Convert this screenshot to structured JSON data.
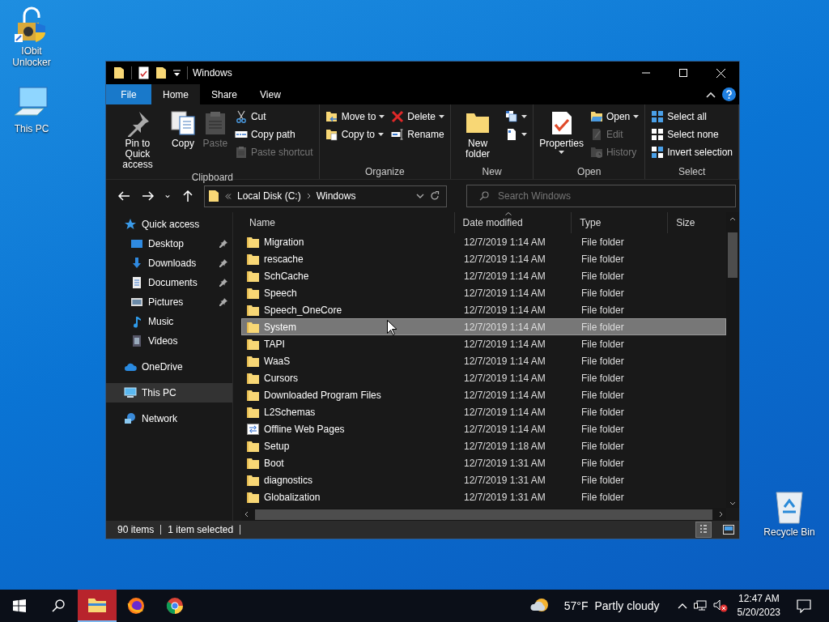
{
  "desktop_icons": [
    {
      "label": "IObit Unlocker",
      "kind": "unlocker"
    },
    {
      "label": "This PC",
      "kind": "pc"
    },
    {
      "label": "Recycle Bin",
      "kind": "bin"
    }
  ],
  "window": {
    "title": "Windows",
    "ribbon_tabs": [
      {
        "label": "File",
        "kind": "file",
        "selected": false
      },
      {
        "label": "Home",
        "kind": "tab",
        "selected": true
      },
      {
        "label": "Share",
        "kind": "tab",
        "selected": false
      },
      {
        "label": "View",
        "kind": "tab",
        "selected": false
      }
    ],
    "ribbon_groups": [
      {
        "label": "Clipboard",
        "columns": [
          {
            "kind": "large",
            "items": [
              {
                "label": "Pin to Quick access",
                "kind": "pin",
                "disabled": false,
                "dropdown": false
              }
            ]
          },
          {
            "kind": "large",
            "items": [
              {
                "label": "Copy",
                "kind": "copy",
                "disabled": false,
                "dropdown": false
              }
            ]
          },
          {
            "kind": "large",
            "items": [
              {
                "label": "Paste",
                "kind": "paste",
                "disabled": true,
                "dropdown": false
              }
            ]
          },
          {
            "kind": "stack",
            "items": [
              {
                "label": "Cut",
                "kind": "cut",
                "disabled": false,
                "dropdown": false
              },
              {
                "label": "Copy path",
                "kind": "copypath",
                "disabled": false,
                "dropdown": false
              },
              {
                "label": "Paste shortcut",
                "kind": "pasteshortcut",
                "disabled": true,
                "dropdown": false
              }
            ]
          }
        ]
      },
      {
        "label": "Organize",
        "columns": [
          {
            "kind": "stack",
            "items": [
              {
                "label": "Move to",
                "kind": "moveto",
                "disabled": false,
                "dropdown": true
              },
              {
                "label": "Copy to",
                "kind": "copyto",
                "disabled": false,
                "dropdown": true
              }
            ]
          },
          {
            "kind": "stack",
            "items": [
              {
                "label": "Delete",
                "kind": "delete",
                "disabled": false,
                "dropdown": true
              },
              {
                "label": "Rename",
                "kind": "rename",
                "disabled": false,
                "dropdown": false
              }
            ]
          }
        ]
      },
      {
        "label": "New",
        "columns": [
          {
            "kind": "large",
            "items": [
              {
                "label": "New folder",
                "kind": "newfolder",
                "disabled": false,
                "dropdown": false
              }
            ]
          },
          {
            "kind": "stack",
            "items": [
              {
                "kind": "newitem",
                "disabled": false,
                "dropdown": true
              },
              {
                "kind": "easyaccess",
                "disabled": false,
                "dropdown": true
              }
            ]
          }
        ]
      },
      {
        "label": "Open",
        "columns": [
          {
            "kind": "large",
            "items": [
              {
                "label": "Properties",
                "kind": "properties",
                "disabled": false,
                "dropdown": true
              }
            ]
          },
          {
            "kind": "stack",
            "items": [
              {
                "label": "Open",
                "kind": "open",
                "disabled": false,
                "dropdown": true
              },
              {
                "label": "Edit",
                "kind": "edit",
                "disabled": true,
                "dropdown": false
              },
              {
                "label": "History",
                "kind": "history",
                "disabled": true,
                "dropdown": false
              }
            ]
          }
        ]
      },
      {
        "label": "Select",
        "columns": [
          {
            "kind": "stack",
            "items": [
              {
                "label": "Select all",
                "kind": "selectall",
                "disabled": false,
                "dropdown": false
              },
              {
                "label": "Select none",
                "kind": "selectnone",
                "disabled": false,
                "dropdown": false
              },
              {
                "label": "Invert selection",
                "kind": "invert",
                "disabled": false,
                "dropdown": false
              }
            ]
          }
        ]
      }
    ],
    "address": {
      "path": [
        "Local Disk (C:)",
        "Windows"
      ]
    },
    "search": {
      "placeholder": "Search Windows"
    },
    "navigation": [
      {
        "label": "Quick access",
        "kind": "star",
        "selected": false,
        "children": [
          {
            "label": "Desktop",
            "kind": "desktop",
            "pinned": true,
            "selected": false
          },
          {
            "label": "Downloads",
            "kind": "downloads",
            "pinned": true,
            "selected": false
          },
          {
            "label": "Documents",
            "kind": "documents",
            "pinned": true,
            "selected": false
          },
          {
            "label": "Pictures",
            "kind": "pictures",
            "pinned": true,
            "selected": false
          },
          {
            "label": "Music",
            "kind": "music",
            "pinned": false,
            "selected": false
          },
          {
            "label": "Videos",
            "kind": "videos",
            "pinned": false,
            "selected": false
          }
        ]
      },
      {
        "label": "OneDrive",
        "kind": "cloud",
        "selected": false
      },
      {
        "label": "This PC",
        "kind": "pc",
        "selected": true
      },
      {
        "label": "Network",
        "kind": "network",
        "selected": false
      }
    ],
    "columns": [
      {
        "label": "Name",
        "sorted": false
      },
      {
        "label": "Date modified",
        "sorted": true
      },
      {
        "label": "Type",
        "sorted": false
      },
      {
        "label": "Size",
        "sorted": false
      }
    ],
    "files": [
      {
        "name": "Migration",
        "kind": "folder",
        "date": "12/7/2019 1:14 AM",
        "type": "File folder",
        "selected": false
      },
      {
        "name": "rescache",
        "kind": "folder",
        "date": "12/7/2019 1:14 AM",
        "type": "File folder",
        "selected": false
      },
      {
        "name": "SchCache",
        "kind": "folder",
        "date": "12/7/2019 1:14 AM",
        "type": "File folder",
        "selected": false
      },
      {
        "name": "Speech",
        "kind": "folder",
        "date": "12/7/2019 1:14 AM",
        "type": "File folder",
        "selected": false
      },
      {
        "name": "Speech_OneCore",
        "kind": "folder",
        "date": "12/7/2019 1:14 AM",
        "type": "File folder",
        "selected": false
      },
      {
        "name": "System",
        "kind": "folder",
        "date": "12/7/2019 1:14 AM",
        "type": "File folder",
        "selected": true
      },
      {
        "name": "TAPI",
        "kind": "folder",
        "date": "12/7/2019 1:14 AM",
        "type": "File folder",
        "selected": false
      },
      {
        "name": "WaaS",
        "kind": "folder",
        "date": "12/7/2019 1:14 AM",
        "type": "File folder",
        "selected": false
      },
      {
        "name": "Cursors",
        "kind": "folder",
        "date": "12/7/2019 1:14 AM",
        "type": "File folder",
        "selected": false
      },
      {
        "name": "Downloaded Program Files",
        "kind": "folder",
        "date": "12/7/2019 1:14 AM",
        "type": "File folder",
        "selected": false
      },
      {
        "name": "L2Schemas",
        "kind": "folder",
        "date": "12/7/2019 1:14 AM",
        "type": "File folder",
        "selected": false
      },
      {
        "name": "Offline Web Pages",
        "kind": "webpages",
        "date": "12/7/2019 1:14 AM",
        "type": "File folder",
        "selected": false
      },
      {
        "name": "Setup",
        "kind": "folder",
        "date": "12/7/2019 1:18 AM",
        "type": "File folder",
        "selected": false
      },
      {
        "name": "Boot",
        "kind": "folder",
        "date": "12/7/2019 1:31 AM",
        "type": "File folder",
        "selected": false
      },
      {
        "name": "diagnostics",
        "kind": "folder",
        "date": "12/7/2019 1:31 AM",
        "type": "File folder",
        "selected": false
      },
      {
        "name": "Globalization",
        "kind": "folder",
        "date": "12/7/2019 1:31 AM",
        "type": "File folder",
        "selected": false
      }
    ],
    "status_bar": {
      "items": "90 items",
      "selection": "1 item selected"
    },
    "view_buttons": [
      {
        "kind": "details",
        "selected": true
      },
      {
        "kind": "tiles",
        "selected": false
      }
    ]
  },
  "taskbar": {
    "apps": [
      {
        "kind": "explorer",
        "active": true
      },
      {
        "kind": "firefox",
        "active": false
      },
      {
        "kind": "chrome",
        "active": false
      }
    ],
    "weather": {
      "temperature": "57°F",
      "condition": "Partly cloudy"
    },
    "time": "12:47 AM",
    "date": "5/20/2023"
  }
}
